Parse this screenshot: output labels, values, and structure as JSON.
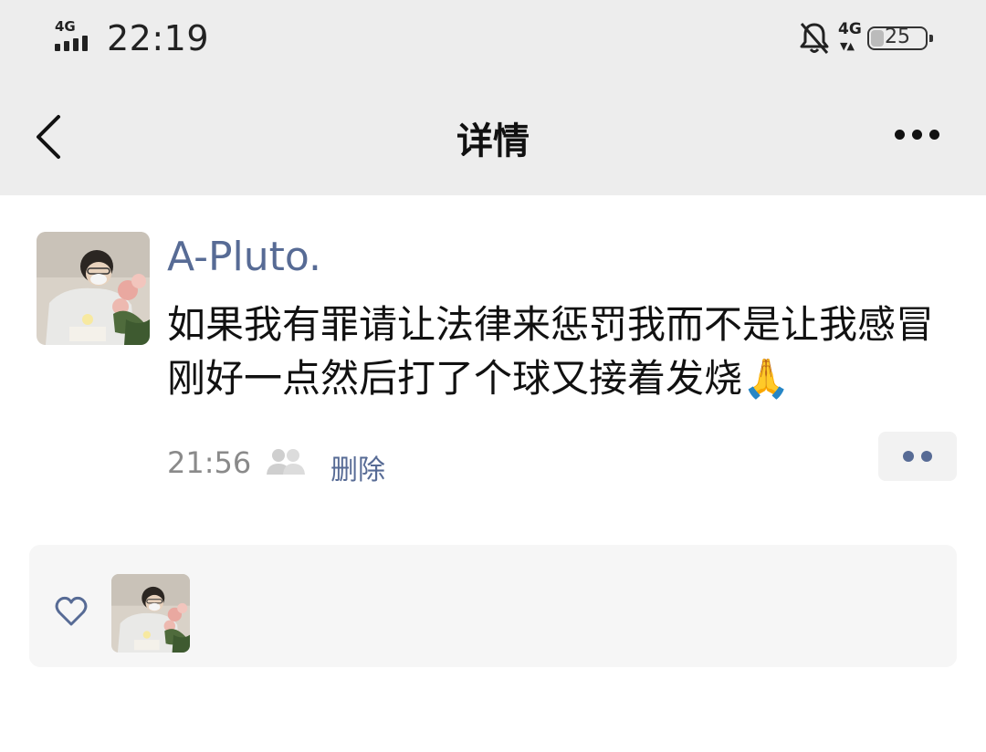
{
  "status_bar": {
    "time": "22:19",
    "signal_label": "4G",
    "signal_bars": 4,
    "network_label": "4G",
    "battery_level": "25"
  },
  "nav": {
    "title": "详情",
    "back_icon": "chevron-left-icon",
    "more_icon": "more-horizontal-icon"
  },
  "post": {
    "author": "A-Pluto.",
    "text": "如果我有罪请让法律来惩罚我而不是让我感冒刚好一点然后打了个球又接着发烧🙏",
    "time": "21:56",
    "visibility_icon": "group-icon",
    "delete_label": "删除",
    "action_icon": "more-dots-icon"
  },
  "likes": {
    "icon": "heart-icon",
    "count": 1
  },
  "colors": {
    "accent": "#576b95",
    "topbar_bg": "#ededed",
    "likes_bg": "#f6f6f6"
  }
}
